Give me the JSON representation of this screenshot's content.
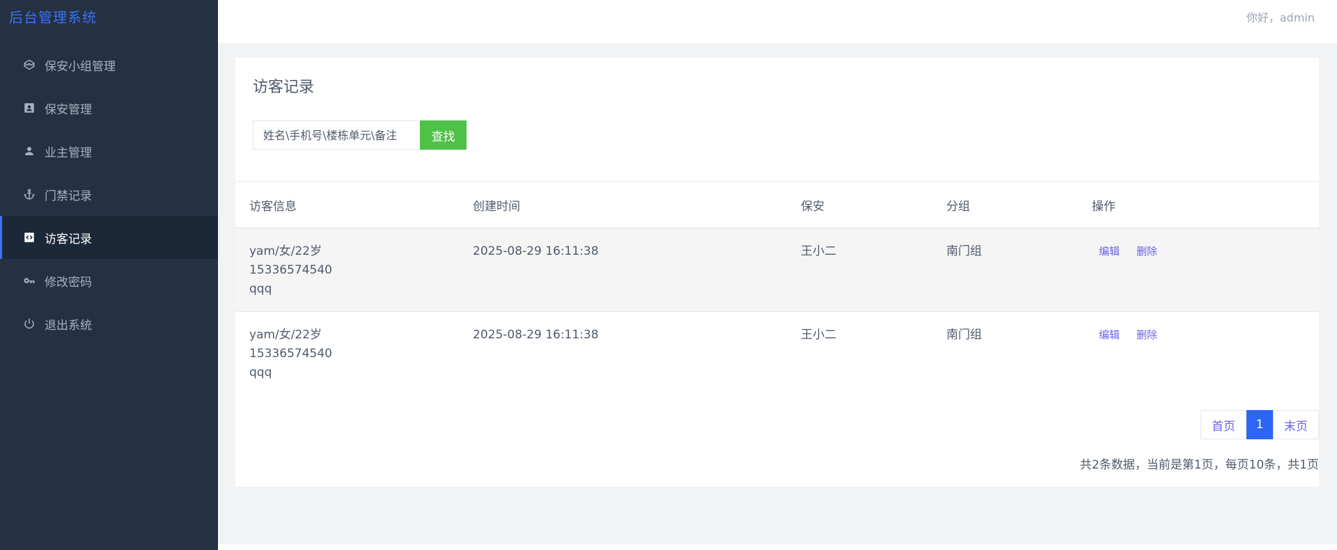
{
  "app": {
    "brand": "后台管理系统"
  },
  "sidebar": {
    "items": [
      {
        "label": "保安小组管理",
        "icon": "codepen-icon",
        "active": false
      },
      {
        "label": "保安管理",
        "icon": "id-card-icon",
        "active": false
      },
      {
        "label": "业主管理",
        "icon": "user-icon",
        "active": false
      },
      {
        "label": "门禁记录",
        "icon": "anchor-icon",
        "active": false
      },
      {
        "label": "访客记录",
        "icon": "code-icon",
        "active": true
      },
      {
        "label": "修改密码",
        "icon": "key-icon",
        "active": false
      },
      {
        "label": "退出系统",
        "icon": "power-icon",
        "active": false
      }
    ]
  },
  "header": {
    "greeting": "你好，admin"
  },
  "main": {
    "title": "访客记录",
    "search": {
      "placeholder": "姓名\\手机号\\楼栋单元\\备注",
      "button_label": "查找"
    },
    "table": {
      "columns": [
        "访客信息",
        "创建时间",
        "保安",
        "分组",
        "操作"
      ],
      "rows": [
        {
          "info": [
            "yam/女/22岁",
            "15336574540",
            "qqq"
          ],
          "created": "2025-08-29 16:11:38",
          "guard": "王小二",
          "group": "南门组",
          "edit": "编辑",
          "delete": "删除"
        },
        {
          "info": [
            "yam/女/22岁",
            "15336574540",
            "qqq"
          ],
          "created": "2025-08-29 16:11:38",
          "guard": "王小二",
          "group": "南门组",
          "edit": "编辑",
          "delete": "删除"
        }
      ]
    },
    "pagination": {
      "first": "首页",
      "current": "1",
      "last": "末页",
      "summary": "共2条数据，当前是第1页，每页10条，共1页"
    }
  },
  "colors": {
    "sidebar_bg": "#233142",
    "accent": "#2d66f5",
    "search_button": "#4ec146",
    "link": "#6a61ea"
  }
}
